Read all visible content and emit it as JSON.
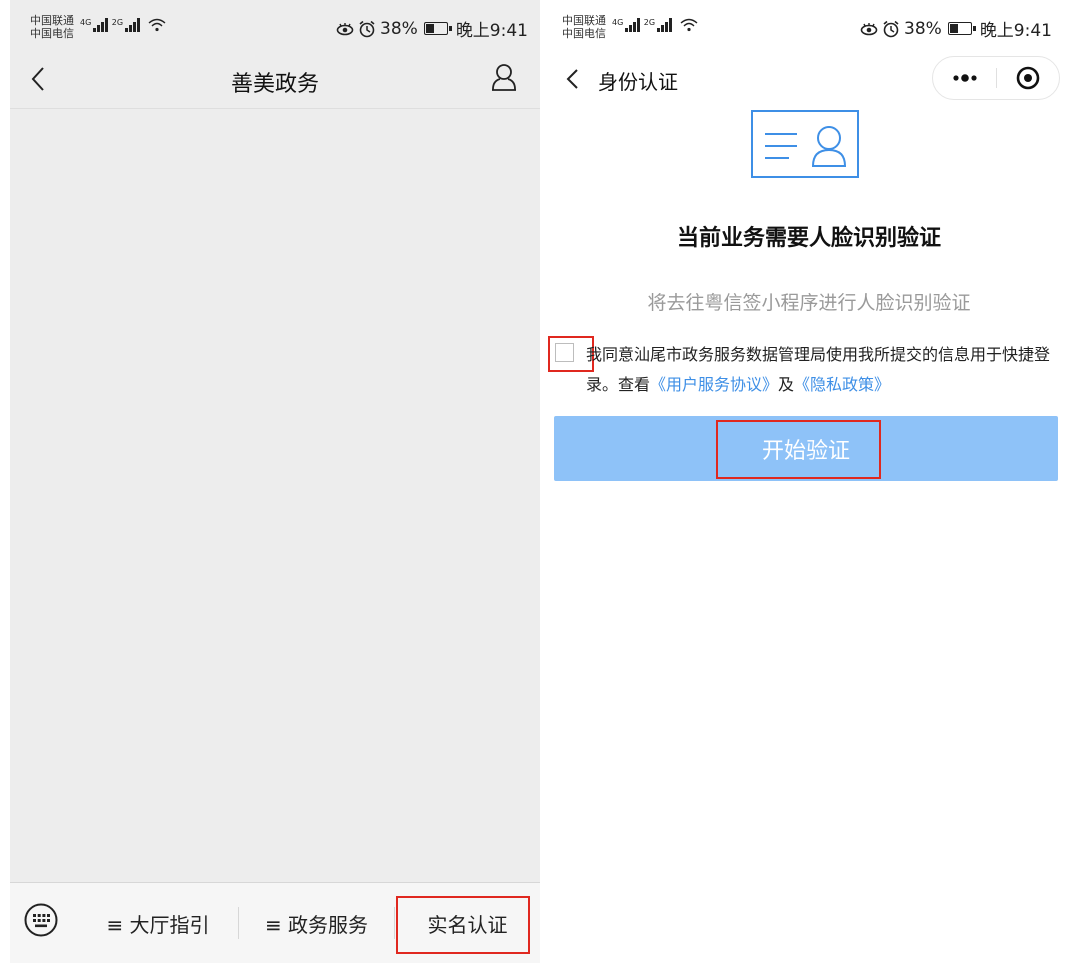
{
  "status_bar": {
    "carrier_1": "中国联通",
    "carrier_2": "中国电信",
    "net_1": "4G",
    "net_2": "2G",
    "battery": "38%",
    "time": "晚上9:41"
  },
  "left_screen": {
    "title": "善美政务",
    "menu": {
      "item_1": "≡ 大厅指引",
      "item_2": "≡ 政务服务",
      "item_3": "实名认证"
    }
  },
  "right_screen": {
    "title": "身份认证",
    "heading": "当前业务需要人脸识别验证",
    "subtitle": "将去往粤信签小程序进行人脸识别验证",
    "agreement": {
      "text_1": "我同意汕尾市政务服务数据管理局使用我所提交的信息用于快捷登录。查看",
      "link_1": "《用户服务协议》",
      "text_2": "及",
      "link_2": "《隐私政策》"
    },
    "button": "开始验证"
  },
  "colors": {
    "accent_blue": "#3e8fe6",
    "button_blue": "#8ec2f8",
    "highlight_red": "#e0281f"
  },
  "icons": [
    "back-icon",
    "user-icon",
    "keyboard-icon",
    "more-icon",
    "close-miniprogram-icon",
    "id-card-icon",
    "wifi-icon",
    "eye-icon",
    "alarm-icon"
  ]
}
